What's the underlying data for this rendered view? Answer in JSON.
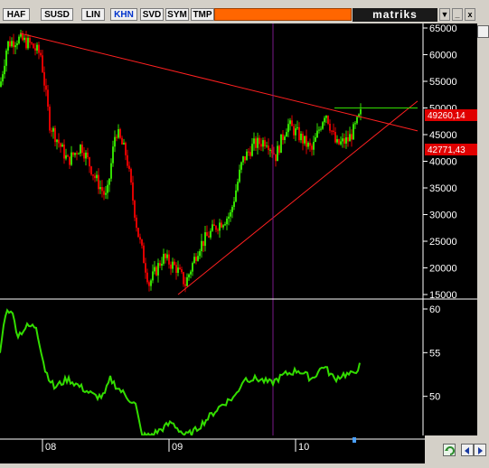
{
  "toolbar": {
    "tabs": [
      "HAF",
      "SUSD",
      "LIN",
      "KHN",
      "SVD",
      "SYM",
      "TMP"
    ],
    "active_tab": "KHN",
    "brand": "matriks",
    "window_buttons": [
      "▼",
      "_",
      "x"
    ]
  },
  "price_panel": {
    "y_ticks": [
      "65000",
      "60000",
      "55000",
      "50000",
      "45000",
      "40000",
      "35000",
      "30000",
      "25000",
      "20000",
      "15000"
    ],
    "price_labels": [
      "49260,14",
      "42771,43"
    ]
  },
  "indicator_panel": {
    "y_ticks": [
      "60",
      "55",
      "50"
    ]
  },
  "x_axis": {
    "ticks": [
      "08",
      "09",
      "10"
    ]
  },
  "colors": {
    "up": "#33dd00",
    "down": "#dd0000",
    "indicator": "#33dd00",
    "trendline": "#ff2020",
    "vertical_marker": "#7a1a8a",
    "accent": "#ff6600",
    "label_bg": "#e00000"
  },
  "chart_data": [
    {
      "type": "candlestick",
      "ylim": [
        15000,
        65000
      ],
      "x": [
        "08",
        "09",
        "10"
      ]
    },
    {
      "type": "line",
      "ylim": [
        45,
        60
      ]
    }
  ]
}
